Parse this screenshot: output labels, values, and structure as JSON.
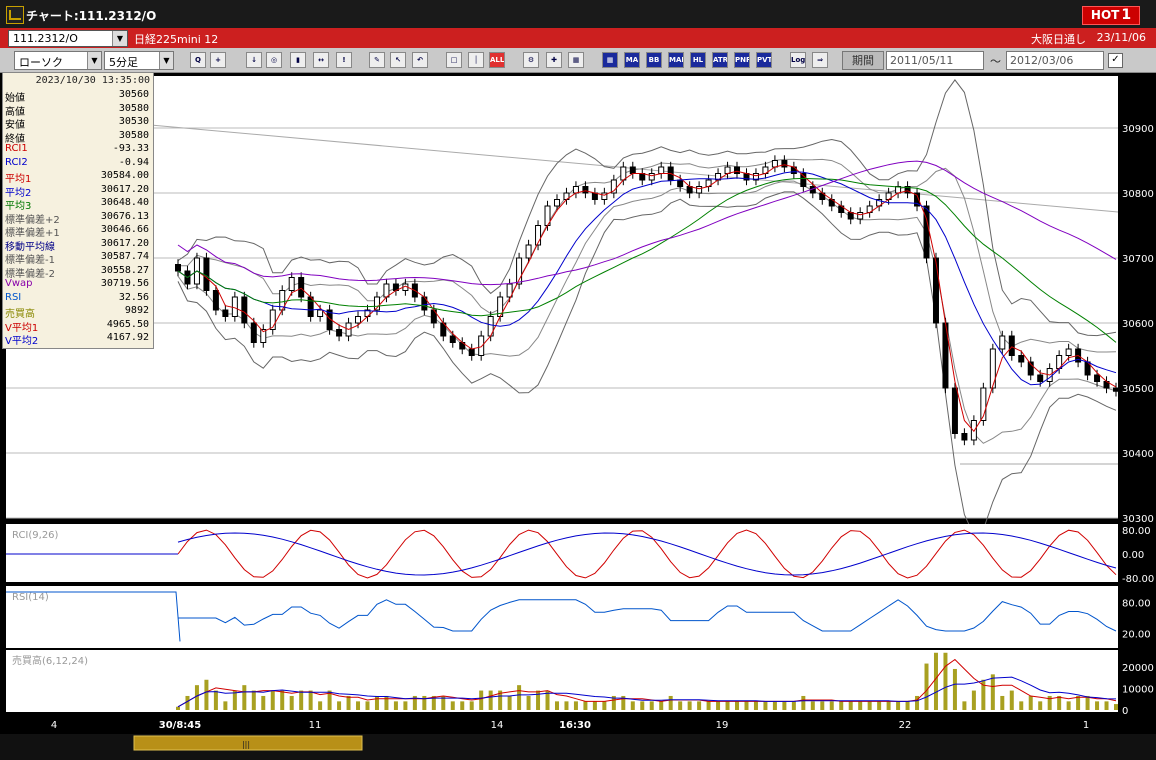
{
  "window": {
    "title": "チャート:111.2312/O",
    "hot_label": "HOT",
    "hot_count": "1"
  },
  "infobar": {
    "symbol": "111.2312/O",
    "security_name": "日経225mini 12",
    "market": "大阪日通し",
    "date": "23/11/06"
  },
  "toolbar": {
    "chart_type": "ローソク",
    "interval": "5分足",
    "period_label": "期間",
    "start_date": "2011/05/11",
    "range_sep": "～",
    "end_date": "2012/03/06",
    "icons": [
      {
        "name": "zoom-icon",
        "label": "Q"
      },
      {
        "name": "crosshair-icon",
        "label": "+"
      },
      {
        "name": "candle-down-icon",
        "label": "↓"
      },
      {
        "name": "magnify-icon",
        "label": "◎"
      },
      {
        "name": "bar-icon",
        "label": "▮"
      },
      {
        "name": "arrows-icon",
        "label": "↔"
      },
      {
        "name": "warning-icon",
        "label": "!"
      },
      {
        "name": "pencil-icon",
        "label": "✎"
      },
      {
        "name": "cursor-icon",
        "label": "↖"
      },
      {
        "name": "undo-icon",
        "label": "↶"
      },
      {
        "name": "box-icon",
        "label": "□"
      },
      {
        "name": "line-icon",
        "label": "│"
      },
      {
        "name": "all-icon",
        "label": "ALL"
      },
      {
        "name": "gear-icon",
        "label": "⚙"
      },
      {
        "name": "tools-icon",
        "label": "✚"
      },
      {
        "name": "palette-icon",
        "label": "▦"
      },
      {
        "name": "grid-icon",
        "label": "▦"
      },
      {
        "name": "ma-icon",
        "label": "MA"
      },
      {
        "name": "bb-icon",
        "label": "BB"
      },
      {
        "name": "mae-icon",
        "label": "MAE"
      },
      {
        "name": "hl-icon",
        "label": "HL"
      },
      {
        "name": "atr-icon",
        "label": "ATR"
      },
      {
        "name": "pnf-icon",
        "label": "PNF"
      },
      {
        "name": "pvt-icon",
        "label": "PVT"
      },
      {
        "name": "log-icon",
        "label": "Log"
      },
      {
        "name": "export-icon",
        "label": "⇒"
      }
    ]
  },
  "legend": {
    "timestamp": "2023/10/30  13:35:00",
    "rows": [
      {
        "name": "始値",
        "value": "30560",
        "color": "#000000"
      },
      {
        "name": "高値",
        "value": "30580",
        "color": "#000000"
      },
      {
        "name": "安値",
        "value": "30530",
        "color": "#000000"
      },
      {
        "name": "終値",
        "value": "30580",
        "color": "#000000"
      },
      {
        "name": "RCI1",
        "value": "-93.33",
        "color": "#cc0000"
      },
      {
        "name": "RCI2",
        "value": "-0.94",
        "color": "#0000cc"
      },
      {
        "name": "平均1",
        "value": "30584.00",
        "color": "#cc0000"
      },
      {
        "name": "平均2",
        "value": "30617.20",
        "color": "#0000cc"
      },
      {
        "name": "平均3",
        "value": "30648.40",
        "color": "#007700"
      },
      {
        "name": "標準偏差+2",
        "value": "30676.13",
        "color": "#555555"
      },
      {
        "name": "標準偏差+1",
        "value": "30646.66",
        "color": "#555555"
      },
      {
        "name": "移動平均線",
        "value": "30617.20",
        "color": "#000088"
      },
      {
        "name": "標準偏差-1",
        "value": "30587.74",
        "color": "#555555"
      },
      {
        "name": "標準偏差-2",
        "value": "30558.27",
        "color": "#555555"
      },
      {
        "name": "Vwap",
        "value": "30719.56",
        "color": "#8800aa"
      },
      {
        "name": "RSI",
        "value": "32.56",
        "color": "#0055cc"
      },
      {
        "name": "売買高",
        "value": "9892",
        "color": "#888800"
      },
      {
        "name": "V平均1",
        "value": "4965.50",
        "color": "#cc0000"
      },
      {
        "name": "V平均2",
        "value": "4167.92",
        "color": "#0000cc"
      }
    ]
  },
  "price_axis": [
    "30900",
    "30800",
    "30700",
    "30600",
    "30500",
    "30400",
    "30300"
  ],
  "rci_panel": {
    "title": "RCI(9,26)",
    "ticks": [
      "80.00",
      "0.00",
      "-80.00"
    ]
  },
  "rsi_panel": {
    "title": "RSI(14)",
    "ticks": [
      "80.00",
      "20.00"
    ]
  },
  "vol_panel": {
    "title": "売買高(6,12,24)",
    "ticks": [
      "20000",
      "10000",
      "0"
    ]
  },
  "time_axis": [
    "4",
    "30/8:45",
    "11",
    "14",
    "16:30",
    "19",
    "22",
    "1"
  ],
  "chart_data": {
    "type": "candlestick",
    "price_range": [
      30300,
      30980
    ],
    "close_series": [
      30680,
      30660,
      30700,
      30650,
      30620,
      30610,
      30640,
      30600,
      30570,
      30590,
      30620,
      30650,
      30670,
      30640,
      30610,
      30620,
      30590,
      30580,
      30600,
      30610,
      30620,
      30640,
      30660,
      30650,
      30660,
      30640,
      30620,
      30600,
      30580,
      30570,
      30560,
      30550,
      30580,
      30610,
      30640,
      30660,
      30700,
      30720,
      30750,
      30780,
      30790,
      30800,
      30810,
      30800,
      30790,
      30800,
      30820,
      30840,
      30830,
      30820,
      30830,
      30840,
      30820,
      30810,
      30800,
      30810,
      30820,
      30830,
      30840,
      30830,
      30820,
      30830,
      30840,
      30850,
      30840,
      30830,
      30810,
      30800,
      30790,
      30780,
      30770,
      30760,
      30770,
      30780,
      30790,
      30800,
      30810,
      30800,
      30780,
      30700,
      30600,
      30500,
      30430,
      30420,
      30450,
      30500,
      30560,
      30580,
      30550,
      30540,
      30520,
      30510,
      30530,
      30550,
      30560,
      30540,
      30520,
      30510,
      30500,
      30495
    ]
  }
}
